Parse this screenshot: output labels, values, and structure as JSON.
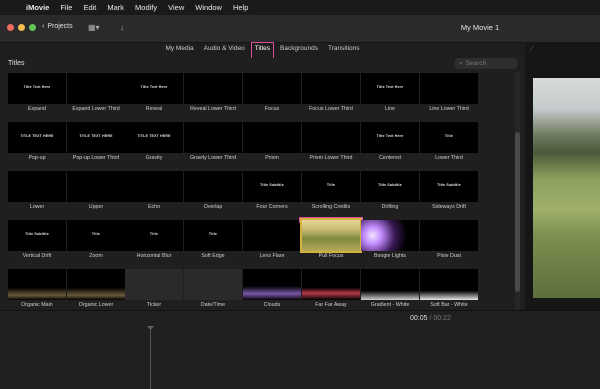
{
  "menubar": {
    "apple": "",
    "items": [
      "iMovie",
      "File",
      "Edit",
      "Mark",
      "Modify",
      "View",
      "Window",
      "Help"
    ]
  },
  "toolbar": {
    "back_label": "Projects",
    "window_title": "My Movie 1"
  },
  "tabs": [
    "My Media",
    "Audio & Video",
    "Titles",
    "Backgrounds",
    "Transitions"
  ],
  "active_tab": "Titles",
  "browser": {
    "title": "Titles",
    "search_placeholder": "Search"
  },
  "titles": [
    {
      "label": "Expand",
      "text": "Title Text Here"
    },
    {
      "label": "Expand Lower Third",
      "text": ""
    },
    {
      "label": "Reveal",
      "text": "Title Text Here"
    },
    {
      "label": "Reveal Lower Third",
      "text": ""
    },
    {
      "label": "Focus",
      "text": ""
    },
    {
      "label": "Focus Lower Third",
      "text": ""
    },
    {
      "label": "Line",
      "text": "Title Text Here"
    },
    {
      "label": "Line Lower Third",
      "text": ""
    },
    {
      "label": "Pop-up",
      "text": "TITLE TEXT HERE"
    },
    {
      "label": "Pop-up Lower Third",
      "text": "TITLE TEXT HERE"
    },
    {
      "label": "Gravity",
      "text": "TITLE TEXT HERE"
    },
    {
      "label": "Gravity Lower Third",
      "text": ""
    },
    {
      "label": "Prism",
      "text": ""
    },
    {
      "label": "Prism Lower Third",
      "text": ""
    },
    {
      "label": "Centered",
      "text": "Title Text Here"
    },
    {
      "label": "Lower Third",
      "text": "Title"
    },
    {
      "label": "Lower",
      "text": ""
    },
    {
      "label": "Upper",
      "text": ""
    },
    {
      "label": "Echo",
      "text": ""
    },
    {
      "label": "Overlap",
      "text": ""
    },
    {
      "label": "Four Corners",
      "text": "Title Subtitle"
    },
    {
      "label": "Scrolling Credits",
      "text": "Title"
    },
    {
      "label": "Drifting",
      "text": "Title Subtitle"
    },
    {
      "label": "Sideways Drift",
      "text": "Title Subtitle"
    },
    {
      "label": "Vertical Drift",
      "text": "Title Subtitle"
    },
    {
      "label": "Zoom",
      "text": "Title"
    },
    {
      "label": "Horizontal Blur",
      "text": "Title"
    },
    {
      "label": "Soft Edge",
      "text": "Title"
    },
    {
      "label": "Lens Flare",
      "text": ""
    },
    {
      "label": "Pull Focus",
      "text": ""
    },
    {
      "label": "Boogie Lights",
      "text": ""
    },
    {
      "label": "Pixie Dust",
      "text": ""
    },
    {
      "label": "Organic Main",
      "text": ""
    },
    {
      "label": "Organic Lower",
      "text": ""
    },
    {
      "label": "Ticker",
      "text": ""
    },
    {
      "label": "Date/Time",
      "text": ""
    },
    {
      "label": "Clouds",
      "text": ""
    },
    {
      "label": "Far Far Away",
      "text": ""
    },
    {
      "label": "Gradient - White",
      "text": ""
    },
    {
      "label": "Soft Bar - White",
      "text": ""
    }
  ],
  "selected_title": "Pull Focus",
  "timeline": {
    "current": "00:05",
    "separator": "/",
    "total": "00:22"
  }
}
